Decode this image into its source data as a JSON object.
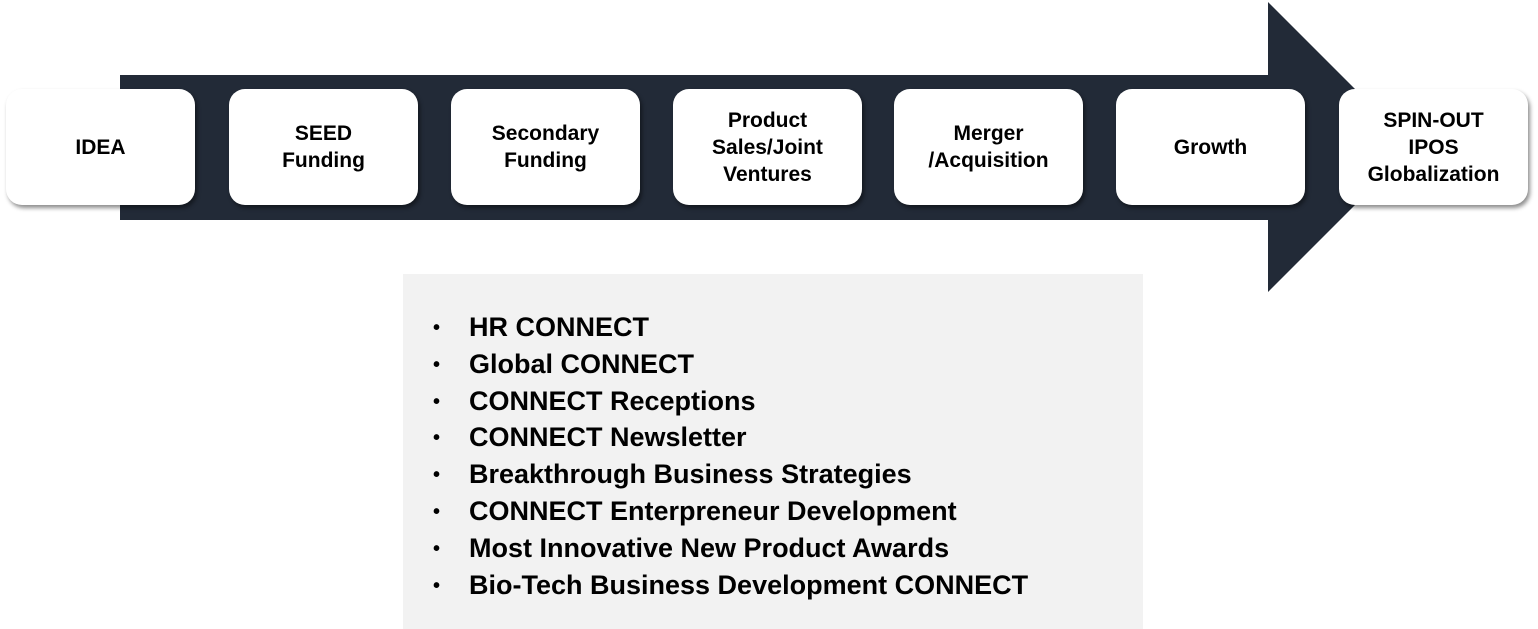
{
  "colors": {
    "arrow": "#222a37",
    "panel": "#f2f2f2",
    "box": "#ffffff"
  },
  "stages": [
    {
      "label": "IDEA"
    },
    {
      "label": "SEED\nFunding"
    },
    {
      "label": "Secondary\nFunding"
    },
    {
      "label": "Product\nSales/Joint\nVentures"
    },
    {
      "label": "Merger\n/Acquisition"
    },
    {
      "label": "Growth"
    },
    {
      "label": "SPIN-OUT\nIPOS\nGlobalization"
    }
  ],
  "programs": {
    "bullet": "•",
    "items": [
      "HR CONNECT",
      "Global CONNECT",
      "CONNECT Receptions",
      "CONNECT Newsletter",
      "Breakthrough Business Strategies",
      "CONNECT Enterpreneur Development",
      "Most Innovative New Product Awards",
      "Bio-Tech Business Development CONNECT"
    ]
  }
}
